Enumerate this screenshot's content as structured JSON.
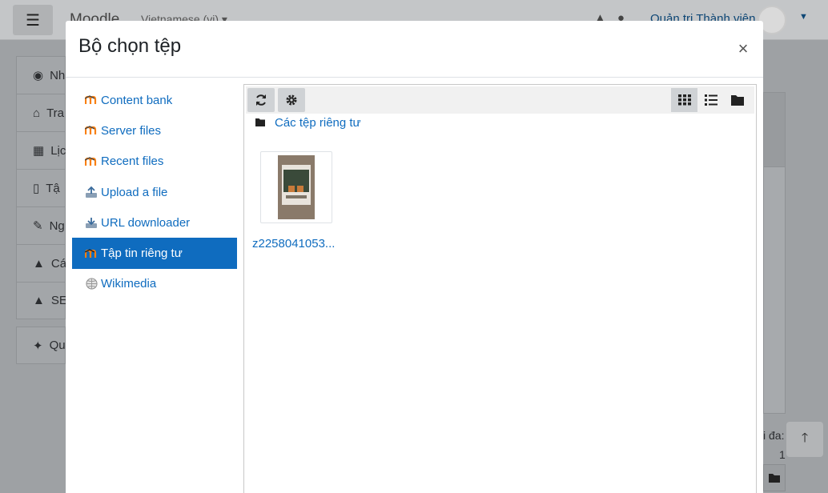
{
  "background": {
    "site_name": "Moodle",
    "language": "Vietnamese (vi)",
    "user_name": "Quản trị Thành viên",
    "nav_items": [
      "Nh",
      "Tra",
      "Lịc",
      "Tậ",
      "Ng",
      "Cá",
      "SE"
    ],
    "nav_item_admin": "Qu",
    "side_text_a": "i đa:",
    "side_text_b": "1"
  },
  "modal": {
    "title": "Bộ chọn tệp",
    "close_label": "×",
    "repositories": [
      {
        "label": "Content bank",
        "icon": "moodle-icon",
        "active": false
      },
      {
        "label": "Server files",
        "icon": "moodle-icon",
        "active": false
      },
      {
        "label": "Recent files",
        "icon": "moodle-icon",
        "active": false
      },
      {
        "label": "Upload a file",
        "icon": "upload-icon",
        "active": false
      },
      {
        "label": "URL downloader",
        "icon": "url-icon",
        "active": false
      },
      {
        "label": "Tập tin riêng tư",
        "icon": "moodle-icon",
        "active": true
      },
      {
        "label": "Wikimedia",
        "icon": "wikimedia-icon",
        "active": false
      }
    ],
    "toolbar": {
      "refresh_icon": "refresh-icon",
      "settings_icon": "gear-icon",
      "views": [
        "grid-view-icon",
        "list-view-icon",
        "tree-view-icon"
      ],
      "active_view": "grid-view-icon"
    },
    "path": {
      "folder_icon": "folder-icon",
      "label": "Các tệp riêng tư"
    },
    "files": [
      {
        "name": "z2258041053..."
      }
    ]
  },
  "colors": {
    "link": "#0f6cbf",
    "active_bg": "#0f6cbf",
    "overlay": "#9ea1a4"
  }
}
